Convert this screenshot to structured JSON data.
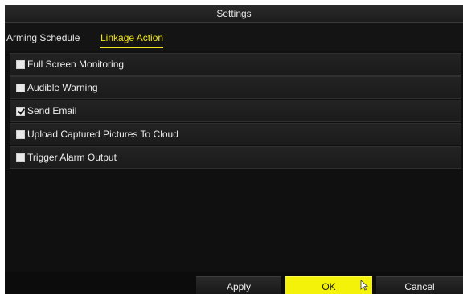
{
  "window": {
    "title": "Settings"
  },
  "tabs": [
    {
      "label": "Arming Schedule",
      "active": false
    },
    {
      "label": "Linkage Action",
      "active": true
    }
  ],
  "linkage_actions": [
    {
      "label": "Full Screen Monitoring",
      "checked": false
    },
    {
      "label": "Audible Warning",
      "checked": false
    },
    {
      "label": "Send Email",
      "checked": true
    },
    {
      "label": "Upload Captured Pictures To Cloud",
      "checked": false
    },
    {
      "label": "Trigger Alarm Output",
      "checked": false
    }
  ],
  "buttons": {
    "apply": "Apply",
    "ok": "OK",
    "cancel": "Cancel"
  },
  "colors": {
    "accent": "#f2e71a",
    "background": "#101010",
    "row": "#1f1f1f",
    "text": "#ececec"
  }
}
